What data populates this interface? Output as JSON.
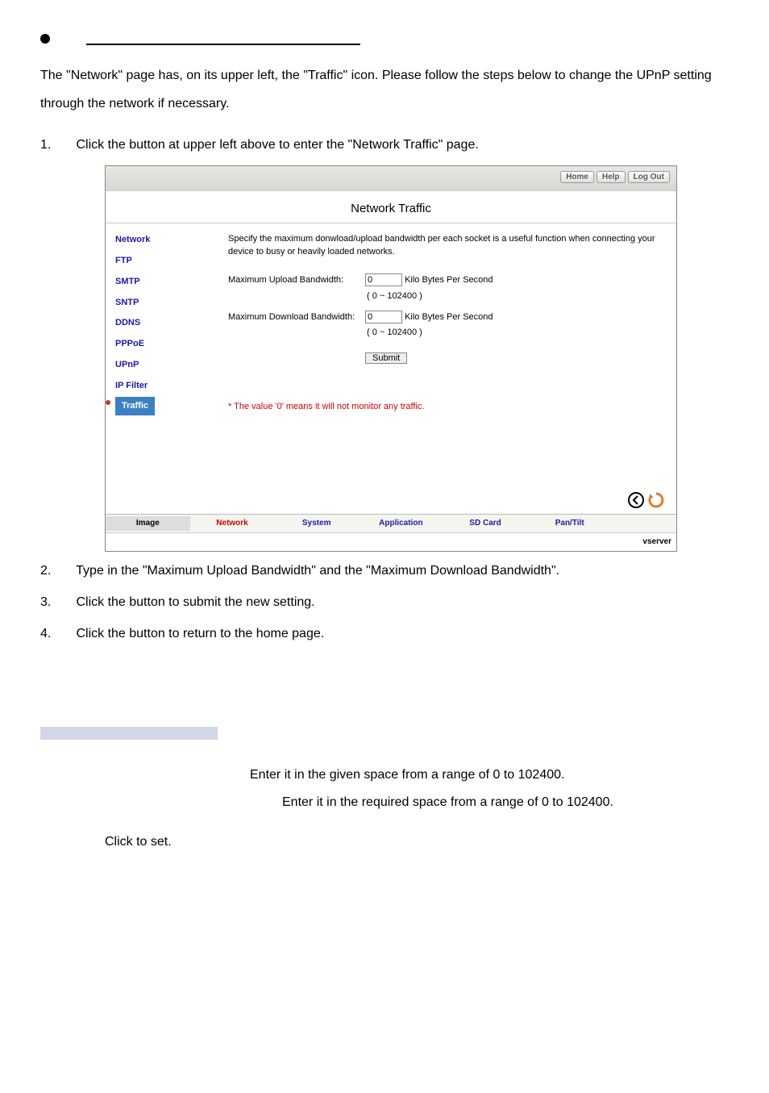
{
  "bullet_blank_width": 340,
  "intro": "The \"Network\" page has, on its upper left, the \"Traffic\" icon. Please follow the steps below to change the UPnP setting through the network if necessary.",
  "steps": {
    "s1_num": "1.",
    "s1": "Click the            button at upper left above to enter the \"Network Traffic\" page.",
    "s2_num": "2.",
    "s2": "Type in the \"Maximum Upload Bandwidth\" and the \"Maximum Download Bandwidth\".",
    "s3_num": "3.",
    "s3": "Click the             button to submit the new setting.",
    "s4_num": "4.",
    "s4": "Click the           button to return to the home page."
  },
  "screenshot": {
    "topnav": {
      "home": "Home",
      "help": "Help",
      "logout": "Log Out"
    },
    "title": "Network Traffic",
    "sidenav": [
      "Network",
      "FTP",
      "SMTP",
      "SNTP",
      "DDNS",
      "PPPoE",
      "UPnP",
      "IP Filter",
      "Traffic"
    ],
    "sidenav_active": "Traffic",
    "desc": "Specify the maximum donwload/upload bandwidth per each socket is a useful function when connecting your device to busy or heavily loaded networks.",
    "rows": {
      "upload_label": "Maximum Upload Bandwidth:",
      "download_label": "Maximum Download Bandwidth:",
      "value": "0",
      "unit": "Kilo Bytes Per Second",
      "range": "( 0 ~ 102400 )"
    },
    "submit_label": "Submit",
    "note": "* The value '0' means it will not monitor any traffic.",
    "tabs": [
      "Image",
      "Network",
      "System",
      "Application",
      "SD Card",
      "Pan/Tilt"
    ],
    "tab_active": "Network",
    "footer": "vserver"
  },
  "descbox": {
    "line1": "Enter it in the given space from a range of 0 to 102400.",
    "line2": "Enter it in the required space from a range of 0 to 102400.",
    "line3": "Click to set."
  }
}
